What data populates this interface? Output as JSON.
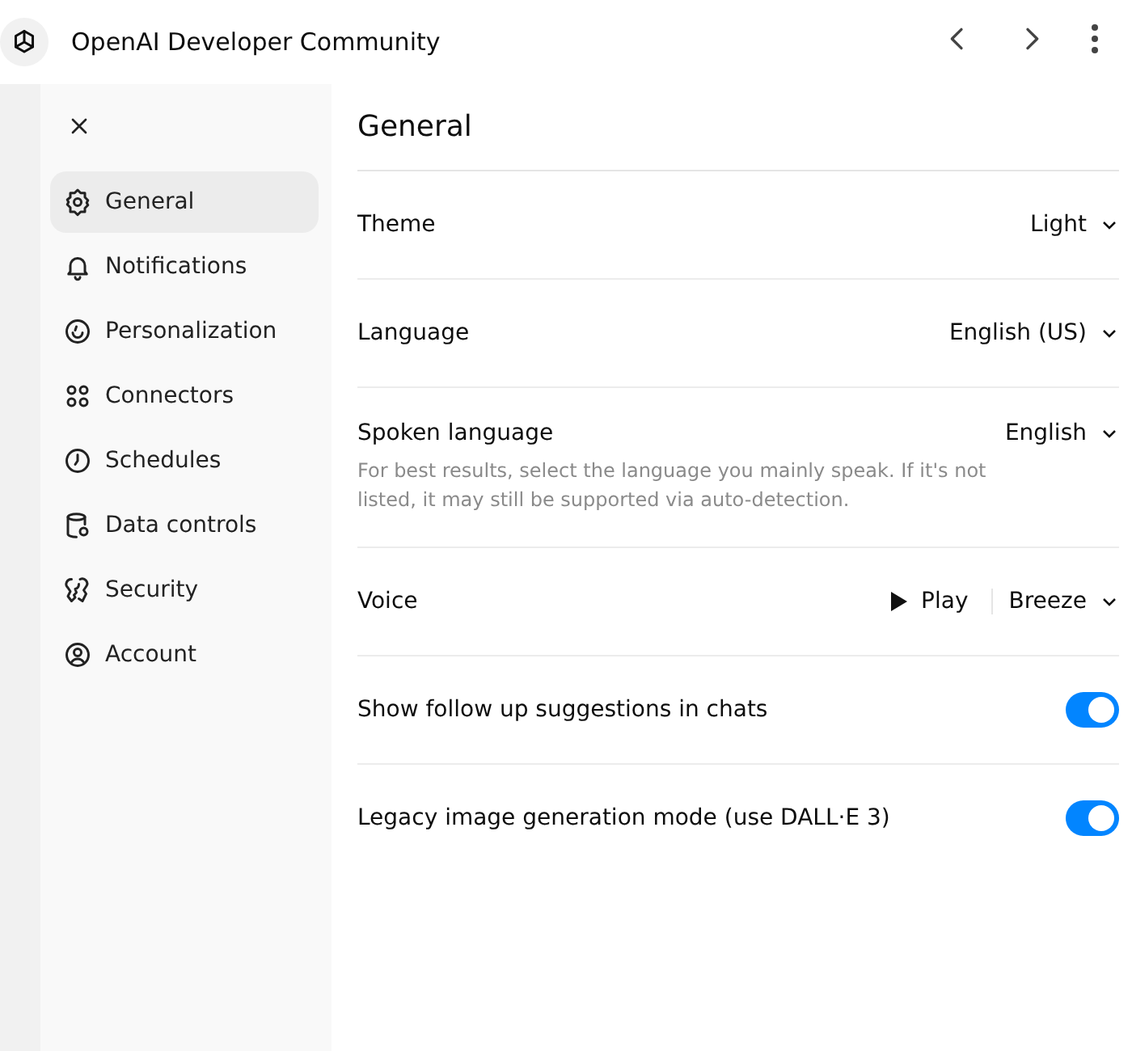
{
  "header": {
    "title": "OpenAI Developer Community"
  },
  "sidebar": {
    "items": [
      {
        "label": "General",
        "selected": true
      },
      {
        "label": "Notifications",
        "selected": false
      },
      {
        "label": "Personalization",
        "selected": false
      },
      {
        "label": "Connectors",
        "selected": false
      },
      {
        "label": "Schedules",
        "selected": false
      },
      {
        "label": "Data controls",
        "selected": false
      },
      {
        "label": "Security",
        "selected": false
      },
      {
        "label": "Account",
        "selected": false
      }
    ]
  },
  "panel": {
    "title": "General",
    "rows": [
      {
        "kind": "select",
        "label": "Theme",
        "value": "Light"
      },
      {
        "kind": "select",
        "label": "Language",
        "value": "English (US)"
      },
      {
        "kind": "select",
        "label": "Spoken language",
        "value": "English",
        "hint": "For best results, select the language you mainly speak. If it's not listed, it may still be supported via auto-detection."
      },
      {
        "kind": "voice",
        "label": "Voice",
        "play": "Play",
        "value": "Breeze"
      },
      {
        "kind": "toggle",
        "label": "Show follow up suggestions in chats",
        "on": true
      },
      {
        "kind": "toggle",
        "label": "Legacy image generation mode (use DALL·E 3)",
        "on": true
      }
    ]
  }
}
